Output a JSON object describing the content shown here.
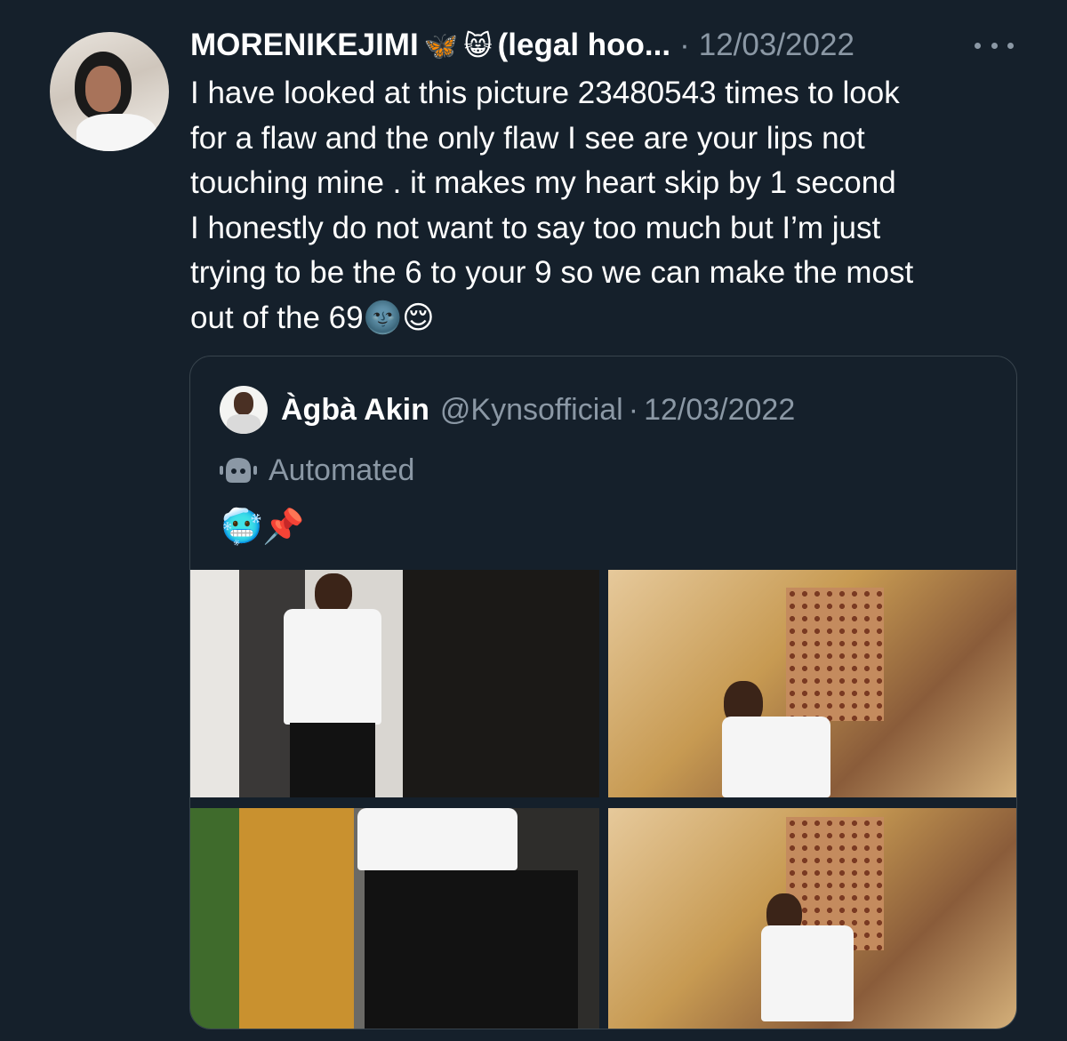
{
  "tweet": {
    "display_name": "MORENIKEJIMI",
    "name_emoji_1": "🦋",
    "name_emoji_2": "😸",
    "name_suffix": "(legal hoo...",
    "separator": "·",
    "date": "12/03/2022",
    "body_lines": [
      "I have looked at this picture 23480543 times to look",
      "for a flaw and the only flaw I see are your lips not",
      "touching mine . it makes my heart skip by 1 second",
      "I honestly do not want to say too much but I’m just",
      "trying to be the 6 to your 9 so we can make the most",
      "out of the 69🌚😌"
    ]
  },
  "quoted": {
    "name": "Àgbà Akin",
    "handle": "@Kynsofficial",
    "separator": "·",
    "date": "12/03/2022",
    "automated_label": "Automated",
    "emojis": "🥶📌",
    "media_count": 4
  },
  "icons": {
    "more": "more-options-icon",
    "automated": "robot-icon"
  },
  "colors": {
    "background": "#15202b",
    "secondary_text": "#8b98a5",
    "border": "#38444d"
  }
}
